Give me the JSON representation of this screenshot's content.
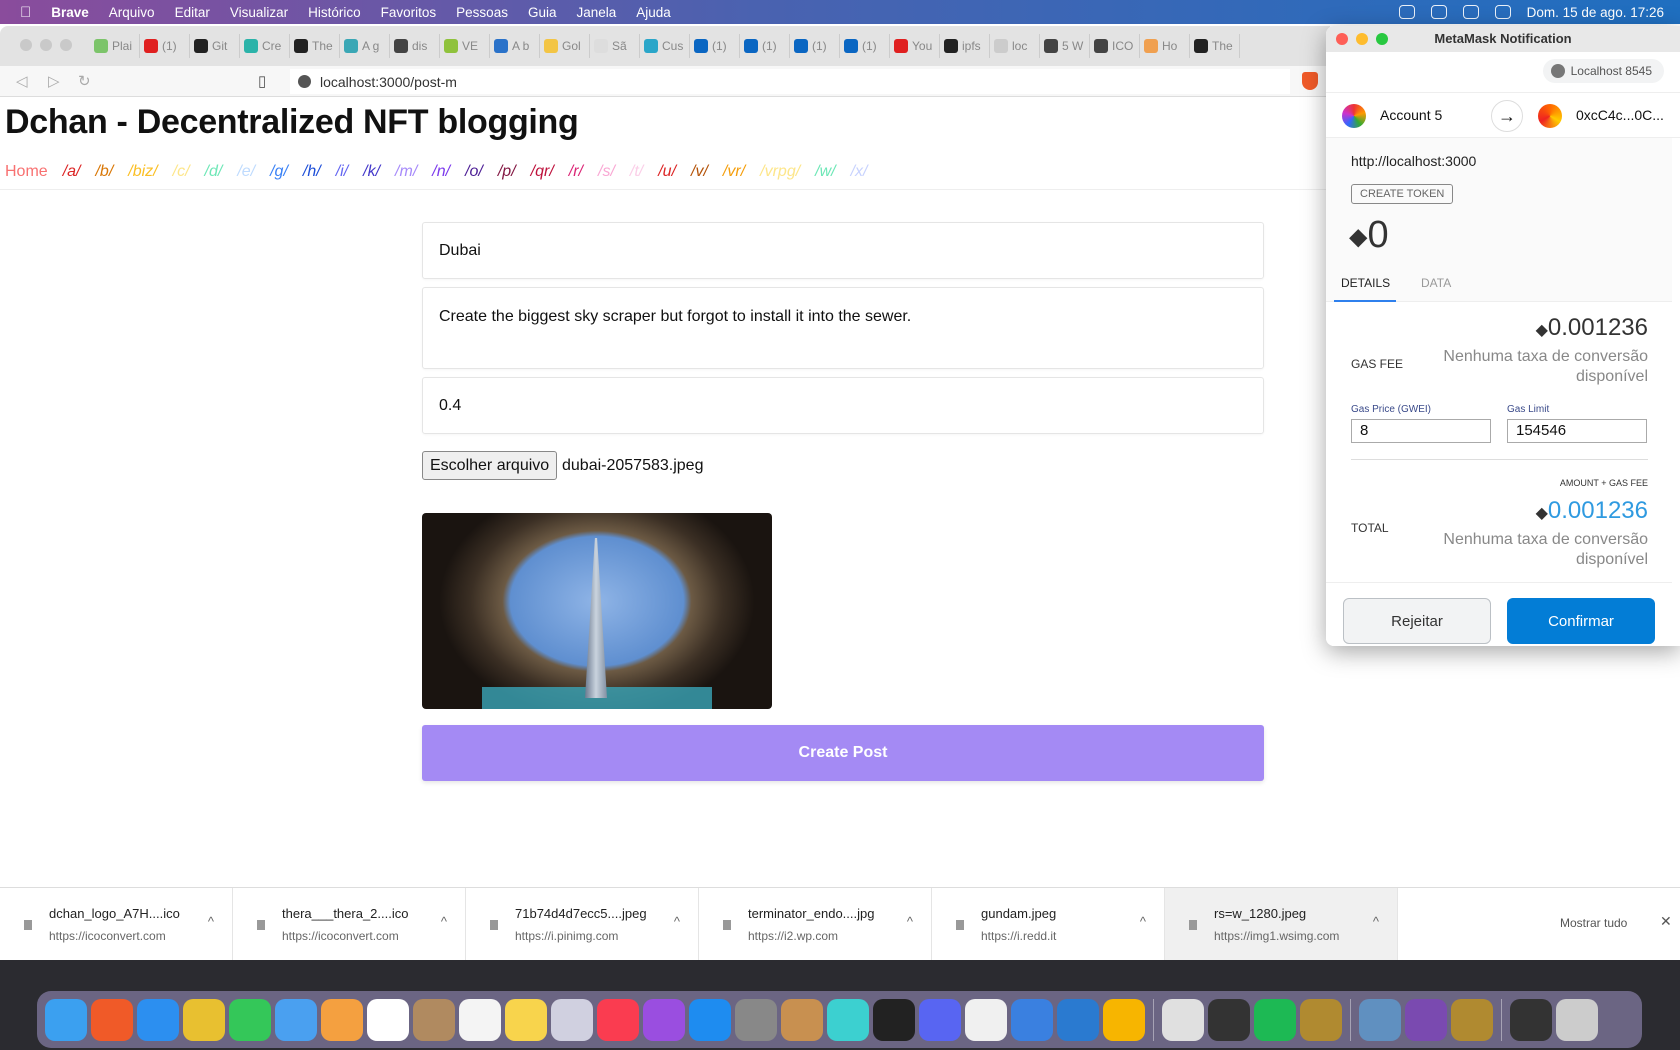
{
  "menubar": {
    "app": "Brave",
    "items": [
      "Arquivo",
      "Editar",
      "Visualizar",
      "Histórico",
      "Favoritos",
      "Pessoas",
      "Guia",
      "Janela",
      "Ajuda"
    ],
    "clock": "Dom. 15 de ago.  17:26"
  },
  "tabs": [
    {
      "label": "Plai",
      "color": "#7cc46a"
    },
    {
      "label": "(1)",
      "color": "#e02020"
    },
    {
      "label": "Git",
      "color": "#222"
    },
    {
      "label": "Cre",
      "color": "#2bb3a9"
    },
    {
      "label": "The",
      "color": "#222"
    },
    {
      "label": "A g",
      "color": "#3aa7b5"
    },
    {
      "label": "dis",
      "color": "#444"
    },
    {
      "label": "VE",
      "color": "#8fc23c"
    },
    {
      "label": "A b",
      "color": "#2a72c9"
    },
    {
      "label": "Gol",
      "color": "#f3c545"
    },
    {
      "label": "Sã",
      "color": "#ddd"
    },
    {
      "label": "Cus",
      "color": "#2aa6c9"
    },
    {
      "label": "(1)",
      "color": "#0a66c2"
    },
    {
      "label": "(1)",
      "color": "#0a66c2"
    },
    {
      "label": "(1)",
      "color": "#0a66c2"
    },
    {
      "label": "(1)",
      "color": "#0a66c2"
    },
    {
      "label": "You",
      "color": "#e02020"
    },
    {
      "label": "ipfs",
      "color": "#222"
    },
    {
      "label": "loc",
      "color": "#ccc"
    },
    {
      "label": "5 W",
      "color": "#444"
    },
    {
      "label": "ICO",
      "color": "#444"
    },
    {
      "label": "Ho",
      "color": "#f0a050"
    },
    {
      "label": "The",
      "color": "#222"
    }
  ],
  "address": {
    "url": "localhost:3000/post-m"
  },
  "page": {
    "title": "Dchan - Decentralized NFT blogging",
    "boards": [
      {
        "label": "Home",
        "color": "#f87171"
      },
      {
        "label": "/a/",
        "color": "#dc2626"
      },
      {
        "label": "/b/",
        "color": "#d97706"
      },
      {
        "label": "/biz/",
        "color": "#fbbf24"
      },
      {
        "label": "/c/",
        "color": "#fde68a"
      },
      {
        "label": "/d/",
        "color": "#6ee7b7"
      },
      {
        "label": "/e/",
        "color": "#bfdbfe"
      },
      {
        "label": "/g/",
        "color": "#3b82f6"
      },
      {
        "label": "/h/",
        "color": "#1d4ed8"
      },
      {
        "label": "/i/",
        "color": "#6366f1"
      },
      {
        "label": "/k/",
        "color": "#4338ca"
      },
      {
        "label": "/m/",
        "color": "#a78bfa"
      },
      {
        "label": "/n/",
        "color": "#7c3aed"
      },
      {
        "label": "/o/",
        "color": "#4c1d95"
      },
      {
        "label": "/p/",
        "color": "#831843"
      },
      {
        "label": "/qr/",
        "color": "#be123c"
      },
      {
        "label": "/r/",
        "color": "#db2777"
      },
      {
        "label": "/s/",
        "color": "#f9a8d4"
      },
      {
        "label": "/t/",
        "color": "#fbcfe8"
      },
      {
        "label": "/u/",
        "color": "#dc2626"
      },
      {
        "label": "/v/",
        "color": "#b45309"
      },
      {
        "label": "/vr/",
        "color": "#f59e0b"
      },
      {
        "label": "/vrpg/",
        "color": "#fde68a"
      },
      {
        "label": "/w/",
        "color": "#6ee7b7"
      },
      {
        "label": "/x/",
        "color": "#c7d2fe"
      }
    ],
    "form": {
      "title_value": "Dubai",
      "description_value": "Create the biggest sky scraper but forgot to install it into the sewer.",
      "price_value": "0.4",
      "file_button": "Escolher arquivo",
      "file_name": "dubai-2057583.jpeg",
      "submit": "Create Post"
    }
  },
  "metamask": {
    "window_title": "MetaMask Notification",
    "network": "Localhost 8545",
    "from_account": "Account 5",
    "to_address": "0xcC4c...0C...",
    "origin": "http://localhost:3000",
    "create_token": "CREATE TOKEN",
    "amount": "0",
    "tabs": [
      "DETAILS",
      "DATA"
    ],
    "gas_fee_label": "GAS FEE",
    "gas_fee": "0.001236",
    "no_conversion": "Nenhuma taxa de conversão disponível",
    "gas_price_label": "Gas Price (GWEI)",
    "gas_price": "8",
    "gas_limit_label": "Gas Limit",
    "gas_limit": "154546",
    "amount_gas_fee": "AMOUNT + GAS FEE",
    "total_label": "TOTAL",
    "total": "0.001236",
    "reject": "Rejeitar",
    "confirm": "Confirmar",
    "accent": "#037dd6"
  },
  "downloads": {
    "items": [
      {
        "name": "dchan_logo_A7H....ico",
        "source": "https://icoconvert.com"
      },
      {
        "name": "thera___thera_2....ico",
        "source": "https://icoconvert.com"
      },
      {
        "name": "71b74d4d7ecc5....jpeg",
        "source": "https://i.pinimg.com"
      },
      {
        "name": "terminator_endo....jpg",
        "source": "https://i2.wp.com"
      },
      {
        "name": "gundam.jpeg",
        "source": "https://i.redd.it"
      },
      {
        "name": "rs=w_1280.jpeg",
        "source": "https://img1.wsimg.com"
      }
    ],
    "show_all": "Mostrar tudo"
  },
  "dock": {
    "apps": [
      {
        "name": "finder",
        "color": "#3ba0f0"
      },
      {
        "name": "brave",
        "color": "#f05a28"
      },
      {
        "name": "safari",
        "color": "#2c8ff0"
      },
      {
        "name": "chrome",
        "color": "#e8c030"
      },
      {
        "name": "messages",
        "color": "#34c759"
      },
      {
        "name": "mail",
        "color": "#4aa0f0"
      },
      {
        "name": "photos",
        "color": "#f4a040"
      },
      {
        "name": "calendar",
        "color": "#ffffff"
      },
      {
        "name": "contacts",
        "color": "#b08a60"
      },
      {
        "name": "reminders",
        "color": "#f4f4f4"
      },
      {
        "name": "notes",
        "color": "#f8d44c"
      },
      {
        "name": "launchpad",
        "color": "#d0d0e0"
      },
      {
        "name": "music",
        "color": "#fa3c50"
      },
      {
        "name": "podcasts",
        "color": "#9a4ee0"
      },
      {
        "name": "app-store",
        "color": "#1e8cf0"
      },
      {
        "name": "system-preferences",
        "color": "#888"
      },
      {
        "name": "archive",
        "color": "#c89050"
      },
      {
        "name": "cube",
        "color": "#3cd0d0"
      },
      {
        "name": "terminal",
        "color": "#222"
      },
      {
        "name": "discord",
        "color": "#5865f2"
      },
      {
        "name": "pages",
        "color": "#f0f0f0"
      },
      {
        "name": "keynote",
        "color": "#3a80e0"
      },
      {
        "name": "vscode",
        "color": "#2a7ad0"
      },
      {
        "name": "sketch",
        "color": "#f7b500"
      },
      {
        "name": "live",
        "color": "#e0e0e0"
      },
      {
        "name": "unity",
        "color": "#333"
      },
      {
        "name": "spotify",
        "color": "#1db954"
      },
      {
        "name": "league",
        "color": "#b08a30"
      },
      {
        "name": "preview",
        "color": "#6090c0"
      },
      {
        "name": "github",
        "color": "#7a4ab0"
      },
      {
        "name": "league-2",
        "color": "#b08a30"
      },
      {
        "name": "screenshot",
        "color": "#333"
      },
      {
        "name": "trash",
        "color": "#ccc"
      }
    ]
  }
}
